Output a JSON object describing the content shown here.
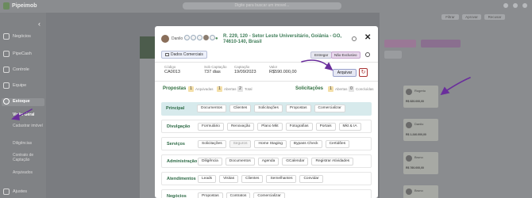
{
  "app": {
    "name": "Pipeimob",
    "search_placeholder": "Digite para buscar um imovel..."
  },
  "sidebar": {
    "items": [
      {
        "label": "Negócios",
        "icon": "briefcase-icon"
      },
      {
        "label": "PipeCash",
        "icon": "cash-icon"
      },
      {
        "label": "Controle",
        "icon": "chart-icon"
      },
      {
        "label": "Equipe",
        "icon": "team-icon"
      },
      {
        "label": "Estoque",
        "icon": "stock-icon"
      }
    ],
    "sub_items": [
      {
        "label": "Visão Geral",
        "active": true
      },
      {
        "label": "Cadastrar imóvel",
        "active": false
      },
      {
        "label": "Diligências",
        "active": false
      },
      {
        "label": "Contrato de Captação",
        "active": false
      },
      {
        "label": "Arquivados",
        "active": false
      }
    ],
    "bottom": {
      "label": "Ajustes",
      "icon": "settings-icon"
    }
  },
  "background": {
    "buttons": [
      "Filtrar",
      "Aprovar",
      "Recusar"
    ],
    "pills": [
      "",
      "",
      ""
    ],
    "cards": [
      {
        "name": "Rogerio",
        "price": "R$ 820.000,00"
      },
      {
        "name": "Danilo",
        "price": "R$ 1.240.000,00"
      },
      {
        "name": "Bruno",
        "price": "R$ 760.000,00"
      },
      {
        "name": "Bruno",
        "price": ""
      }
    ]
  },
  "modal": {
    "owner": "Danilo",
    "address": "R. 229, 120 - Setor Leste Universitário, Goiânia - GO, 74610-140, Brasil",
    "dados_button": "Dados Comerciais",
    "entregar_button": "Entregar",
    "nao_exclusivo_button": "Não Exclusivo",
    "stats": [
      {
        "label": "Código",
        "value": "CA0013"
      },
      {
        "label": "Sob Captação",
        "value": "737 dias"
      },
      {
        "label": "Captação",
        "value": "19/09/2023"
      },
      {
        "label": "Valor",
        "value": "R$590.000,00"
      }
    ],
    "arquivar_button": "Arquivar",
    "propostas": {
      "title": "Propostas",
      "counts": [
        {
          "value": "1",
          "label": "Arquivadas",
          "color": "amber"
        },
        {
          "value": "1",
          "label": "Abertas",
          "color": "amber"
        },
        {
          "value": "2",
          "label": "Total",
          "color": "gray"
        }
      ]
    },
    "solicitacoes": {
      "title": "Solicitações",
      "counts": [
        {
          "value": "1",
          "label": "Abertas",
          "color": "amber"
        },
        {
          "value": "0",
          "label": "Concluídas",
          "color": "gray"
        }
      ]
    },
    "categories": [
      {
        "title": "Principal",
        "highlight": true,
        "items": [
          "Documentos",
          "Clientes",
          "Solicitações",
          "Propostas",
          "Comercializar"
        ],
        "muted": []
      },
      {
        "title": "Divulgação",
        "highlight": false,
        "items": [
          "Formulário",
          "Renovação",
          "Plano Mkt",
          "Fotografias",
          "Portais",
          "Mkt & IA"
        ],
        "muted": []
      },
      {
        "title": "Serviços",
        "highlight": false,
        "items": [
          "Solicitações",
          "Seguros",
          "Home Staging",
          "Bypass Check",
          "Certidões"
        ],
        "muted": [
          1
        ]
      },
      {
        "title": "Administração",
        "highlight": false,
        "items": [
          "Diligência",
          "Documentos",
          "Agenda",
          "GCalendar",
          "Registrar Atividades"
        ],
        "muted": []
      },
      {
        "title": "Atendimentos",
        "highlight": false,
        "items": [
          "Leads",
          "Visitas",
          "Clientes",
          "Semelhantes",
          "Convidar"
        ],
        "muted": []
      },
      {
        "title": "Negócios",
        "highlight": false,
        "items": [
          "Propostas",
          "Contratos",
          "Comercializar"
        ],
        "muted": []
      }
    ]
  },
  "colors": {
    "accent_green": "#2d6a45",
    "annotation_purple": "#6a2e9c",
    "highlight_row": "#d7eaec"
  }
}
